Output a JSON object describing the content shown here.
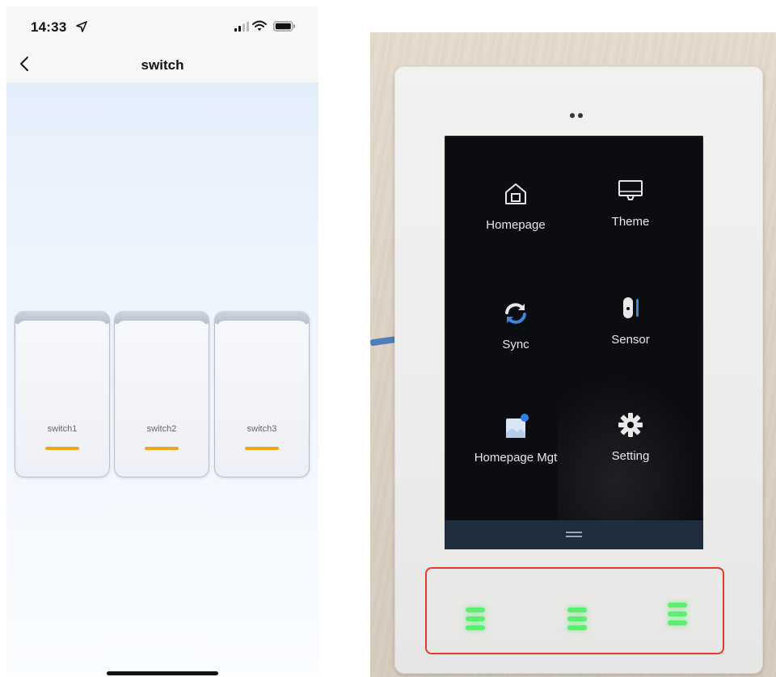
{
  "phone": {
    "status_bar": {
      "time": "14:33"
    },
    "nav": {
      "title": "switch"
    },
    "switches": [
      {
        "label": "switch1"
      },
      {
        "label": "switch2"
      },
      {
        "label": "switch3"
      }
    ],
    "colors": {
      "indicator": "#f0a51e",
      "background_top": "#e4eefb",
      "background_bottom": "#fbfdff"
    }
  },
  "device": {
    "menu": [
      {
        "label": "Homepage",
        "icon": "home-icon"
      },
      {
        "label": "Theme",
        "icon": "monitor-icon"
      },
      {
        "label": "Sync",
        "icon": "sync-icon"
      },
      {
        "label": "Sensor",
        "icon": "sensor-icon"
      },
      {
        "label": "Homepage Mgt",
        "icon": "image-icon"
      },
      {
        "label": "Setting",
        "icon": "gear-icon"
      }
    ],
    "touch_keys_count": 3,
    "colors": {
      "highlight": "#e23b32",
      "key_glow": "#5cef6f",
      "dock": "#1f2c3d"
    }
  }
}
